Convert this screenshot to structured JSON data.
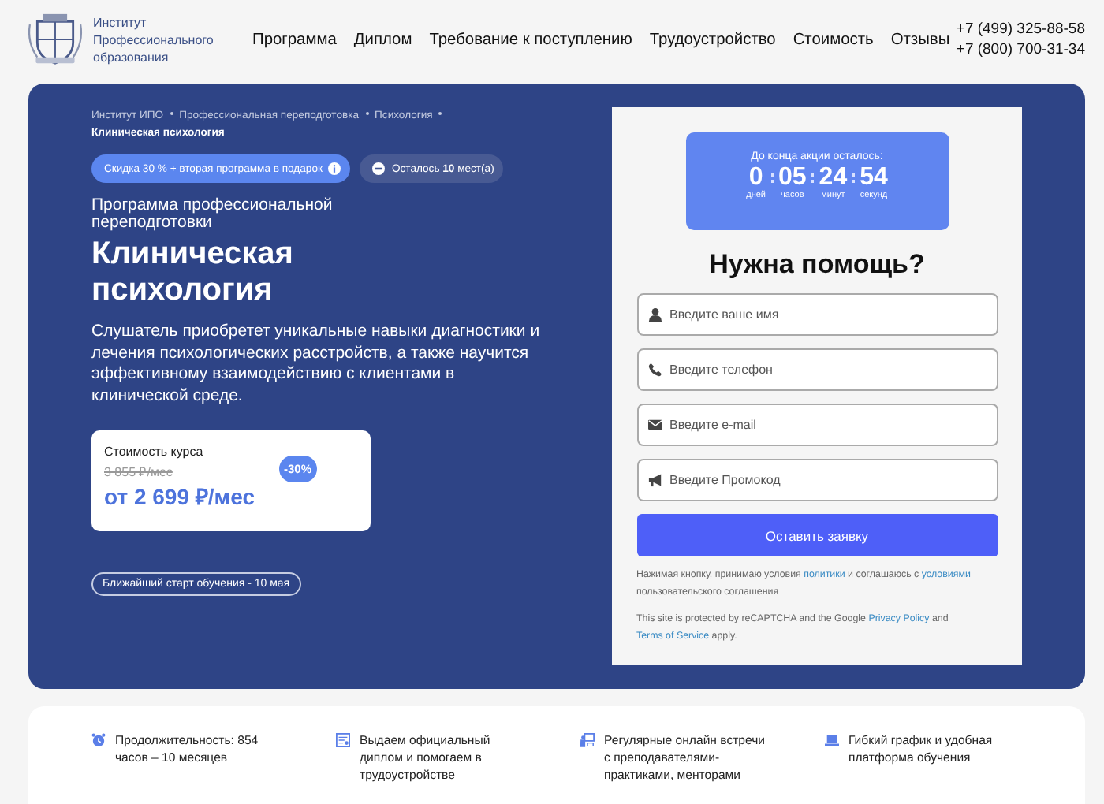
{
  "header": {
    "logo_text": "Институт Профессионального образования",
    "nav": [
      {
        "label": "Программа"
      },
      {
        "label": "Диплом"
      },
      {
        "label": "Требование к поступлению"
      },
      {
        "label": "Трудоустройство"
      },
      {
        "label": "Стоимость"
      },
      {
        "label": "Отзывы"
      }
    ],
    "phones": [
      "+7 (499) 325-88-58",
      "+7 (800) 700-31-34"
    ]
  },
  "hero": {
    "breadcrumbs": [
      {
        "label": "Институт ИПО",
        "current": false
      },
      {
        "label": "Профессиональная переподготовка",
        "current": false
      },
      {
        "label": "Психология",
        "current": false
      },
      {
        "label": "Клиническая психология",
        "current": true
      }
    ],
    "badges": [
      {
        "kind": "discount",
        "text": "Скидка 30 % + вторая программа в подарок"
      },
      {
        "kind": "seats",
        "text": "Осталось **10** мест(а)"
      }
    ],
    "subtitle": "Программа профессиональной переподготовки",
    "title": "Клиническая психология",
    "description": "Слушатель приобретет уникальные навыки диагностики и лечения психологических расстройств, а также научится эффективному взаимодействию с клиентами в клинической среде.",
    "price": {
      "label": "Стоимость курса",
      "old": "3 855 ₽/мес",
      "current": "от 2 699 ₽/мес",
      "discount": "-30%"
    },
    "start": "Ближайший старт обучения - 10 мая"
  },
  "form": {
    "timer": {
      "title": "До конца акции осталось:",
      "units": [
        {
          "value": "0",
          "label": "дней"
        },
        {
          "value": "05",
          "label": "часов"
        },
        {
          "value": "24",
          "label": "минут"
        },
        {
          "value": "54",
          "label": "секунд"
        }
      ]
    },
    "heading": "Нужна помощь?",
    "fields": [
      {
        "kind": "name",
        "placeholder": "Введите ваше имя"
      },
      {
        "kind": "phone",
        "placeholder": "Введите телефон"
      },
      {
        "kind": "email",
        "placeholder": "Введите e-mail"
      },
      {
        "kind": "promo",
        "placeholder": "Введите Промокод"
      }
    ],
    "submit": "Оставить заявку",
    "consent": [
      {
        "text": "Нажимая кнопку, принимаю условия ",
        "link": false
      },
      {
        "text": "политики",
        "link": true
      },
      {
        "text": " и соглашаюсь с ",
        "link": false
      },
      {
        "text": "условиями",
        "link": true
      },
      {
        "text": " пользовательского соглашения",
        "link": false
      }
    ],
    "recaptcha": [
      {
        "text": "This site is protected by reCAPTCHA and the Google ",
        "link": false
      },
      {
        "text": "Privacy Policy",
        "link": true
      },
      {
        "text": " and ",
        "link": false
      },
      {
        "text": "Terms of Service",
        "link": true
      },
      {
        "text": " apply.",
        "link": false
      }
    ]
  },
  "features": [
    {
      "kind": "clock",
      "text": "Продолжительность: 854 часов – 10 месяцев"
    },
    {
      "kind": "diploma",
      "text": "Выдаем официальный диплом и помогаем в трудоустройстве"
    },
    {
      "kind": "meeting",
      "text": "Регулярные онлайн встречи с преподавателями-практиками, менторами"
    },
    {
      "kind": "laptop",
      "text": "Гибкий график и удобная платформа обучения"
    }
  ]
}
